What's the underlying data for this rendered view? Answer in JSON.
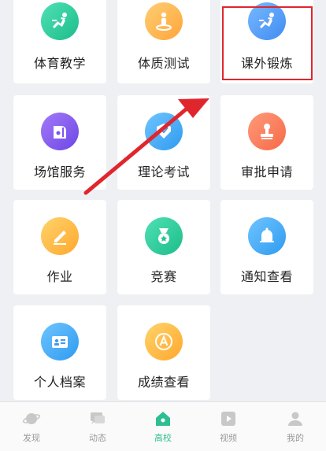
{
  "grid": {
    "tiles": [
      {
        "label": "体育教学"
      },
      {
        "label": "体质测试"
      },
      {
        "label": "课外锻炼"
      },
      {
        "label": "场馆服务"
      },
      {
        "label": "理论考试"
      },
      {
        "label": "审批申请"
      },
      {
        "label": "作业"
      },
      {
        "label": "竞赛"
      },
      {
        "label": "通知查看"
      },
      {
        "label": "个人档案"
      },
      {
        "label": "成绩查看"
      }
    ]
  },
  "tabbar": {
    "items": [
      {
        "label": "发现"
      },
      {
        "label": "动态"
      },
      {
        "label": "高校"
      },
      {
        "label": "视频"
      },
      {
        "label": "我的"
      }
    ],
    "active": "高校"
  },
  "colors": {
    "highlight": "#e0262d",
    "arrow": "#e0262d",
    "active_tab": "#2dbf92"
  }
}
